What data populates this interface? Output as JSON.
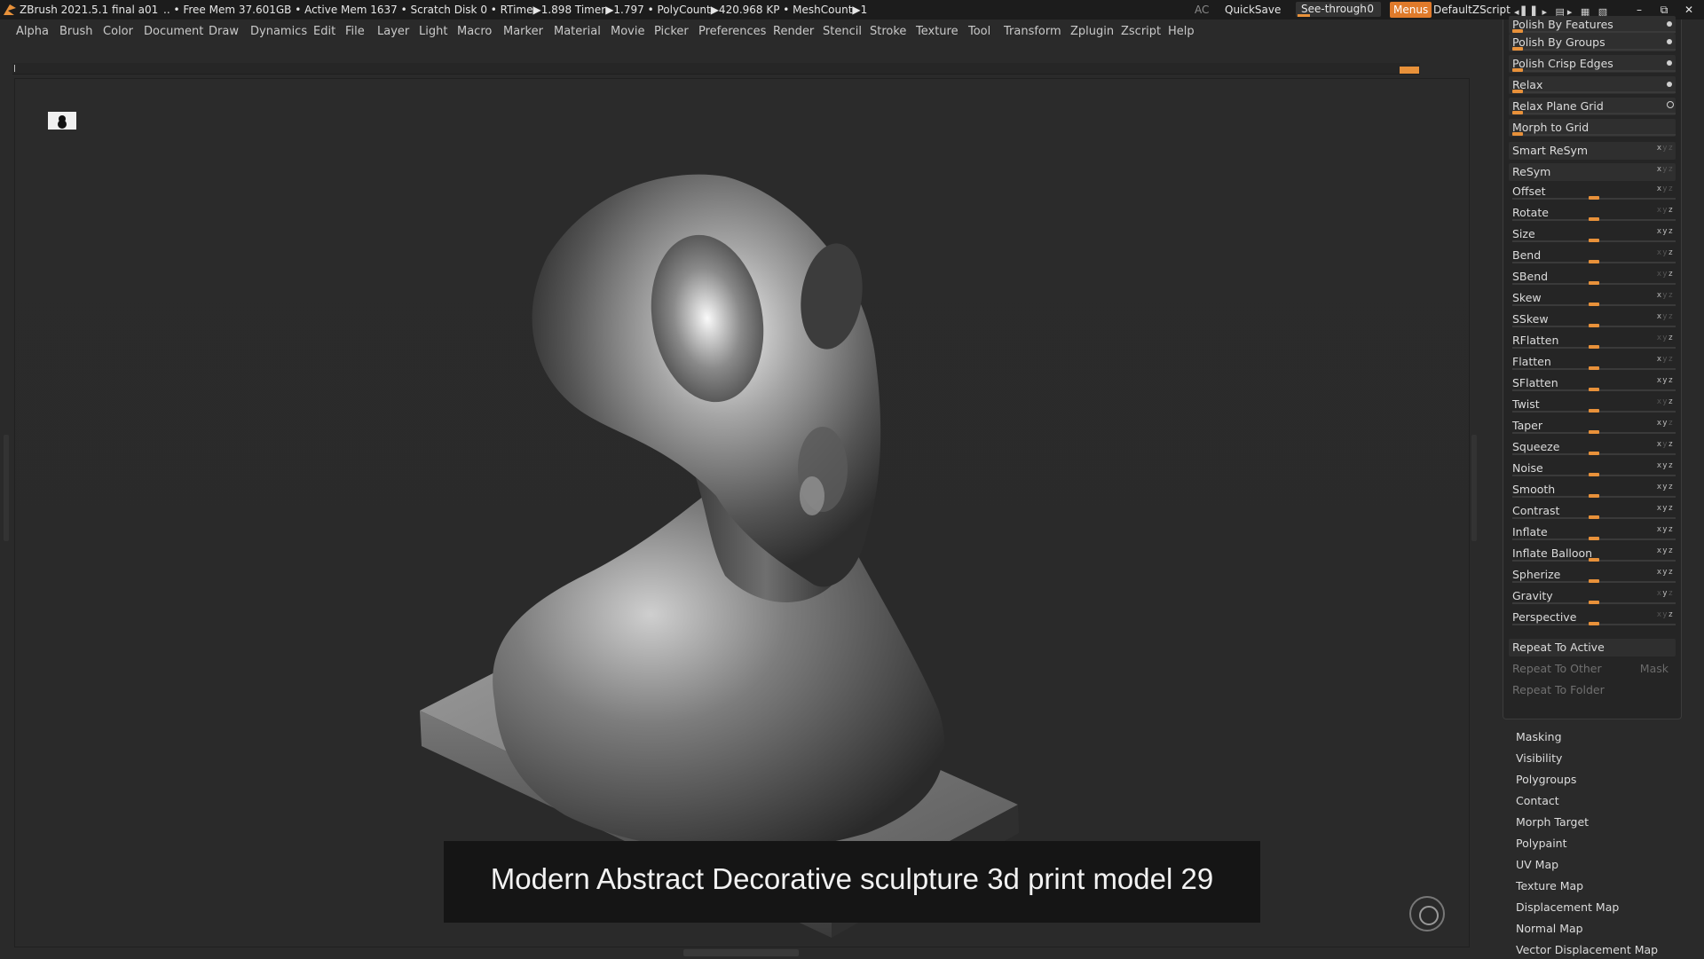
{
  "titlebar": {
    "app": "ZBrush 2021.5.1",
    "doc": "final a01",
    "stats": ".. • Free Mem 37.601GB • Active Mem 1637 • Scratch Disk 0 •   RTime▶1.898 Timer▶1.797 • PolyCount▶420.968 KP  • MeshCount▶1",
    "ac": "AC",
    "quicksave": "QuickSave",
    "seethrough_label": "See-through",
    "seethrough_value": "0",
    "menus": "Menus",
    "default_zscript": "DefaultZScript",
    "icons": "◂▌▌▸ ▤▸ ▦ ▧",
    "minimize": "–",
    "restore": "⧉",
    "close": "✕"
  },
  "menubar": [
    "Alpha",
    "Brush",
    "Color",
    "Document",
    "Draw",
    "Dynamics",
    "Edit",
    "File",
    "Layer",
    "Light",
    "Macro",
    "Marker",
    "Material",
    "Movie",
    "Picker",
    "Preferences",
    "Render",
    "Stencil",
    "Stroke",
    "Texture",
    "Tool",
    "Transform",
    "Zplugin",
    "Zscript",
    "Help"
  ],
  "caption": "Modern Abstract Decorative sculpture 3d print model 29",
  "palette": {
    "top_items": [
      {
        "label": "Polish By Features",
        "ind": "dot"
      },
      {
        "label": "Polish By Groups",
        "ind": "dot"
      },
      {
        "label": "Polish Crisp Edges",
        "ind": "dot"
      },
      {
        "label": "Relax",
        "ind": "dot"
      },
      {
        "label": "Relax Plane Grid",
        "ind": "ring"
      },
      {
        "label": "Morph to Grid",
        "ind": ""
      }
    ],
    "smart_resym": "Smart ReSym",
    "resym": "ReSym",
    "deformers": [
      {
        "label": "Offset",
        "xyz": "x"
      },
      {
        "label": "Rotate",
        "xyz": "z"
      },
      {
        "label": "Size",
        "xyz": "xyz"
      },
      {
        "label": "Bend",
        "xyz": "z"
      },
      {
        "label": "SBend",
        "xyz": "z"
      },
      {
        "label": "Skew",
        "xyz": "x"
      },
      {
        "label": "SSkew",
        "xyz": "x"
      },
      {
        "label": "RFlatten",
        "xyz": "z"
      },
      {
        "label": "Flatten",
        "xyz": "x"
      },
      {
        "label": "SFlatten",
        "xyz": "xyz"
      },
      {
        "label": "Twist",
        "xyz": "z"
      },
      {
        "label": "Taper",
        "xyz": "xy"
      },
      {
        "label": "Squeeze",
        "xyz": "xz"
      },
      {
        "label": "Noise",
        "xyz": "xyz"
      },
      {
        "label": "Smooth",
        "xyz": "xyz"
      },
      {
        "label": "Contrast",
        "xyz": "xyz"
      },
      {
        "label": "Inflate",
        "xyz": "xyz"
      },
      {
        "label": "Inflate Balloon",
        "xyz": "xyz"
      },
      {
        "label": "Spherize",
        "xyz": "xyz"
      },
      {
        "label": "Gravity",
        "xyz": "y"
      },
      {
        "label": "Perspective",
        "xyz": "z"
      }
    ],
    "repeat_active": "Repeat To Active",
    "repeat_other": "Repeat To Other",
    "mask": "Mask",
    "repeat_folder": "Repeat To Folder"
  },
  "subpalettes": [
    "Masking",
    "Visibility",
    "Polygroups",
    "Contact",
    "Morph Target",
    "Polypaint",
    "UV Map",
    "Texture Map",
    "Displacement Map",
    "Normal Map",
    "Vector Displacement Map"
  ],
  "colors": {
    "accent": "#e8913a",
    "background": "#2a2a2a",
    "panel": "#252525"
  }
}
